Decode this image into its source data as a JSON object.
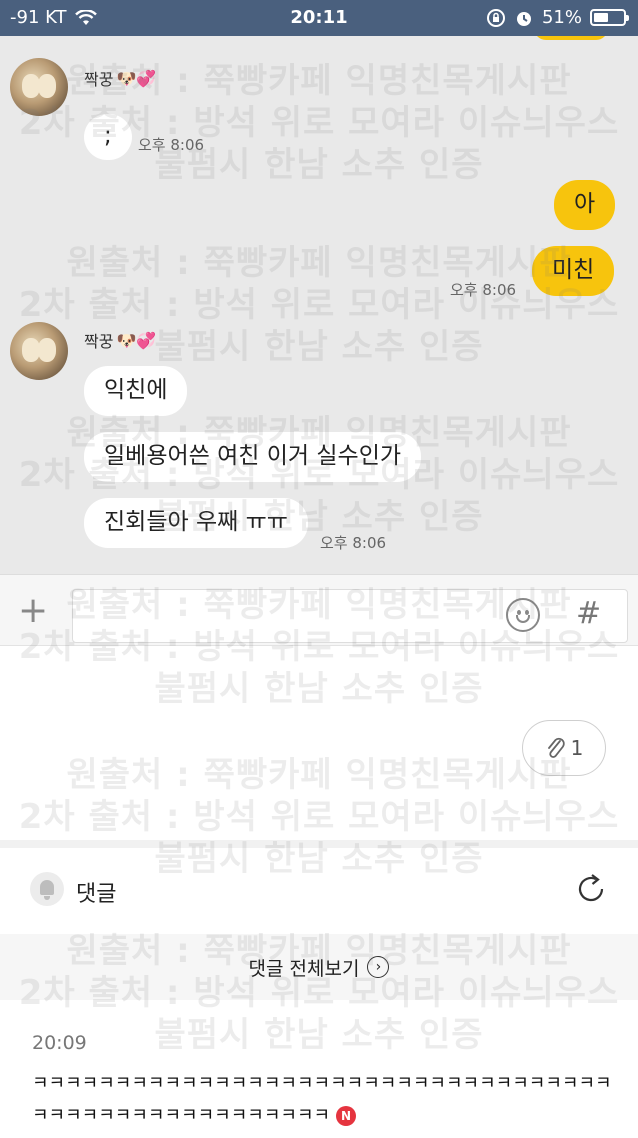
{
  "status_bar": {
    "carrier": "-91 KT",
    "time": "20:11",
    "battery_text": "51%",
    "battery_level": 0.51,
    "icons": [
      "wifi-icon",
      "orientation-lock-icon",
      "alarm-icon",
      "battery-icon"
    ]
  },
  "chat": {
    "group1": {
      "sender": "짝꿍",
      "sender_emoji": "🐶💞",
      "messages": [
        ";"
      ],
      "time": "오후 8:06"
    },
    "outgoing": {
      "messages": [
        "아",
        "미친"
      ],
      "time": "오후 8:06"
    },
    "group2": {
      "sender": "짝꿍",
      "sender_emoji": "🐶💞",
      "messages": [
        "익친에",
        "일베용어쓴 여친 이거 실수인가",
        "진회들아 우째 ㅠㅠ"
      ],
      "time": "오후 8:06"
    }
  },
  "input_bar": {
    "plus": "+",
    "hash": "#"
  },
  "attachment": {
    "count": "1"
  },
  "comments": {
    "title": "댓글",
    "view_all": "댓글 전체보기",
    "item": {
      "time": "20:09",
      "text": "ㅋㅋㅋㅋㅋㅋㅋㅋㅋㅋㅋㅋㅋㅋㅋㅋㅋㅋㅋㅋㅋㅋㅋㅋㅋㅋㅋㅋㅋㅋㅋㅋㅋㅋㅋㅋㅋㅋㅋㅋㅋㅋㅋㅋㅋㅋㅋㅋㅋㅋㅋㅋㅋ",
      "new_badge": "N"
    }
  },
  "watermark": {
    "line1": "원출처 : 쭉빵카페 익명친목게시판",
    "line2": "2차 출처 : 방석 위로 모여라 이슈늬우스",
    "line3": "불펌시 한남 소추 인증"
  },
  "colors": {
    "status_bar": "#4a607e",
    "chat_bg": "#e9e9e9",
    "outgoing_bubble": "#f7c40d",
    "new_badge": "#e5343f"
  }
}
